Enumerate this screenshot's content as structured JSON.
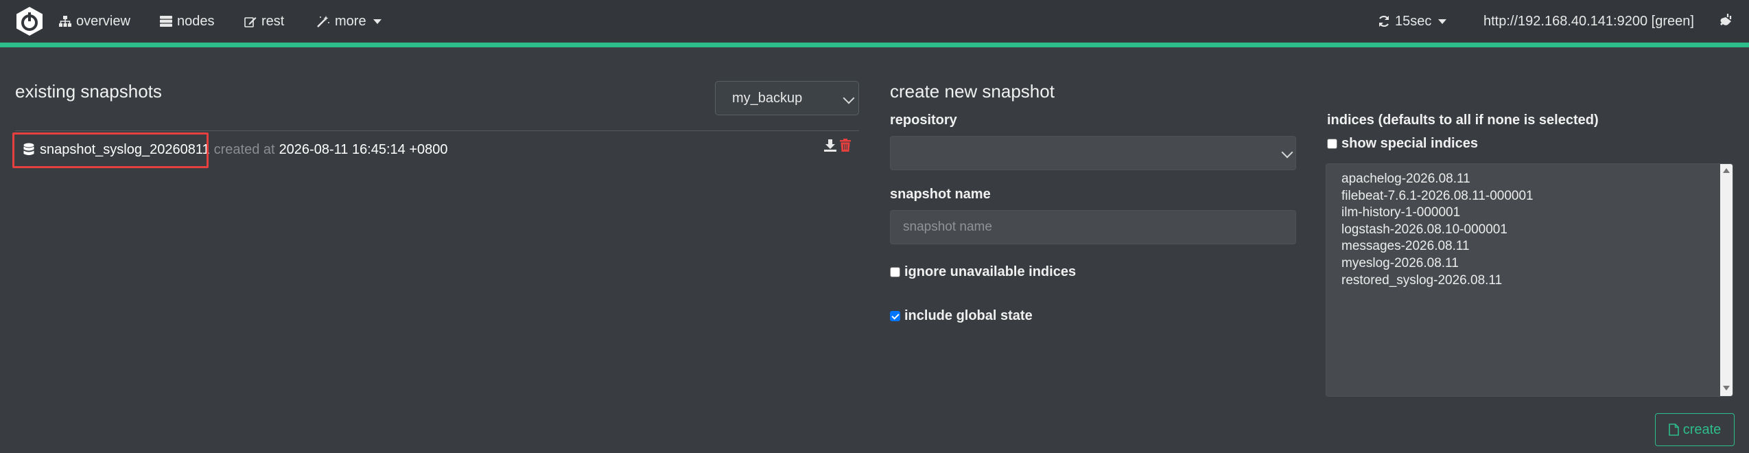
{
  "navbar": {
    "items": [
      {
        "label": "overview",
        "icon": "sitemap-icon"
      },
      {
        "label": "nodes",
        "icon": "server-icon"
      },
      {
        "label": "rest",
        "icon": "edit-icon"
      },
      {
        "label": "more",
        "icon": "magic-wand-icon"
      }
    ],
    "refresh": {
      "label": "15sec",
      "icon": "refresh-icon"
    },
    "cluster": "http://192.168.40.141:9200 [green]",
    "accent_color": "#2dbd8a"
  },
  "existing": {
    "title": "existing snapshots",
    "repository_selected": "my_backup",
    "snapshots": [
      {
        "name": "snapshot_syslog_20260811",
        "created_label": "created at",
        "created_at": "2026-08-11 16:45:14 +0800"
      }
    ]
  },
  "create": {
    "title": "create new snapshot",
    "repository_label": "repository",
    "repository_value": "",
    "snapshot_name_label": "snapshot name",
    "snapshot_name_placeholder": "snapshot name",
    "ignore_unavailable_label": "ignore unavailable indices",
    "ignore_unavailable": false,
    "include_global_label": "include global state",
    "include_global": true,
    "indices_label": "indices (defaults to all if none is selected)",
    "show_special_label": "show special indices",
    "show_special": false,
    "indices": [
      "apachelog-2026.08.11",
      "filebeat-7.6.1-2026.08.11-000001",
      "ilm-history-1-000001",
      "logstash-2026.08.10-000001",
      "messages-2026.08.11",
      "myeslog-2026.08.11",
      "restored_syslog-2026.08.11"
    ],
    "create_button": "create"
  }
}
